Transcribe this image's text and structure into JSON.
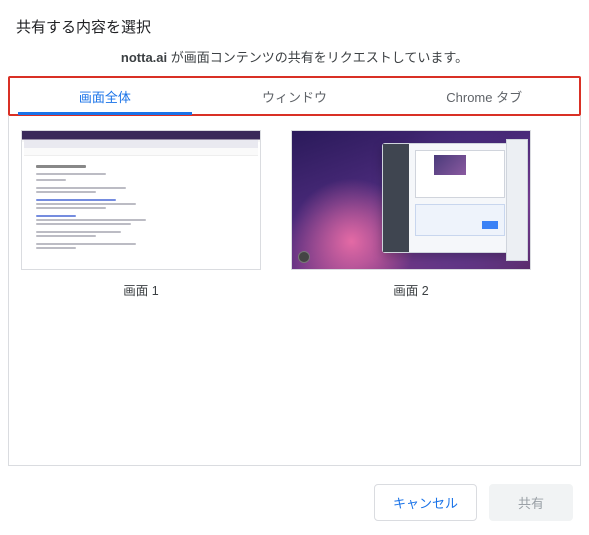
{
  "title": "共有する内容を選択",
  "request_domain": "notta.ai",
  "request_suffix": " が画面コンテンツの共有をリクエストしています。",
  "tabs": [
    {
      "label": "画面全体",
      "active": true
    },
    {
      "label": "ウィンドウ",
      "active": false
    },
    {
      "label": "Chrome タブ",
      "active": false
    }
  ],
  "screens": [
    {
      "label": "画面 1"
    },
    {
      "label": "画面 2"
    }
  ],
  "buttons": {
    "cancel": "キャンセル",
    "share": "共有"
  }
}
